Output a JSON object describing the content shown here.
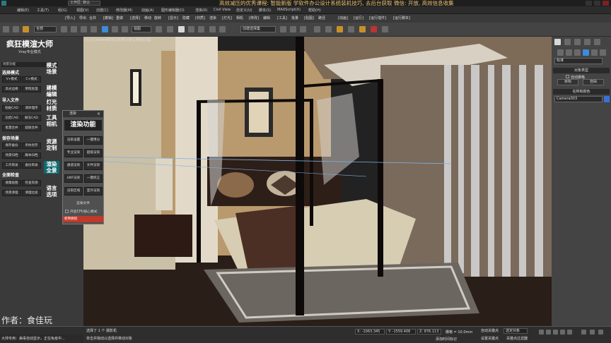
{
  "titlebar": {
    "tab": "工作区: 默认",
    "marquee": "高效减压的优秀课程: 智能新版 学软件办公设计系统装机技巧, 去后台获取  微信: 开放, 高效信息收集"
  },
  "menus": [
    "编辑(E)",
    "工具(T)",
    "组(G)",
    "视图(V)",
    "创建(C)",
    "修改器(M)",
    "动画(A)",
    "图形编辑器(D)",
    "渲染(R)",
    "Civil View",
    "自定义(U)",
    "脚本(S)",
    "MAXScript(X)",
    "帮助(H)"
  ],
  "ribbon_small": [
    "[导入]",
    "导出",
    "合并",
    "[撤销]",
    "重做",
    "[选择]",
    "移动",
    "旋转",
    "[显示]",
    "隐藏",
    "[材质]",
    "渲染",
    "[灯光]",
    "相机",
    "[修改]",
    "编辑",
    "[工具]",
    "批量",
    "[贴图]",
    "路径",
    "[动画]",
    "[运行]",
    "[运行插件]",
    "[运行脚本]"
  ],
  "toolbar": {
    "filter_all": "全部",
    "view_dropdown": "视图",
    "selset_dropdown": "创建选择集"
  },
  "leftpanel": {
    "title": "疯狂模渲大师",
    "subtitle": "Vray专业模式",
    "scene_header": "场景功能",
    "sections": {
      "mode": "选择模式",
      "import": "导入文件",
      "save": "保存场景",
      "check": "全面检查"
    },
    "buttons": [
      [
        "V+模式",
        "C+模式"
      ],
      [
        "高光边缘",
        "明暗处理"
      ],
      [
        "粘贴CAD",
        "调体理序"
      ],
      [
        "冻结CAD",
        "解冻CAD"
      ],
      [
        "批量合并",
        "超级合并"
      ],
      [
        "保存备份",
        "单体另存"
      ],
      [
        "场景归档",
        "脚本归档"
      ],
      [
        "工作目录",
        "备份目录"
      ],
      [
        "收集贴图",
        "检查资源"
      ],
      [
        "场景清理",
        "清理垃圾"
      ]
    ],
    "vtabs": [
      "模式\n场景",
      "建模\n编辑",
      "灯光\n材质",
      "工具\n相机",
      "资源\n定制",
      "渲染\n全景",
      "语言\n选项"
    ],
    "author": "作者：食佳玩"
  },
  "viewport": {
    "label": "[+] [Camera003] [标准] [默认明暗处理]"
  },
  "floatpanel": {
    "header": "渲染",
    "close": "×",
    "title": "渲染功能",
    "buttons": [
      [
        "渲染设置",
        "一键用分"
      ],
      [
        "专业渲染",
        "超级渲染"
      ],
      [
        "通道渲染",
        "文件渲染"
      ],
      [
        "LWF渲染",
        "一键校正"
      ],
      [
        "渲染区域",
        "室外渲染"
      ]
    ],
    "file_label": "渲染文件",
    "checkbox": "开启CPU核心模式",
    "red": "使用教程"
  },
  "rightpanel": {
    "dropdown": "标准",
    "object_type": "对象类型",
    "autogrid": "自动栅格",
    "target": "目标",
    "free": "自由",
    "name_color": "名称和颜色",
    "camera_name": "Camera003"
  },
  "statusbar": {
    "selected": "选择了 1 个 摄影机",
    "hint": "单击并拖动以选择并移动对象",
    "x": "X: -1063.345",
    "y": "Y: -1559.406",
    "z": "Z: 876.113",
    "grid": "栅格 = 10.0mm",
    "autokey": "自动关键点",
    "setkey": "设置关键点",
    "selobj": "选定对象",
    "keyfilter": "关键点过滤器",
    "addtime": "添加时间标记",
    "bottom_left": "大师专用：病毒自动显示，正在免疫中..."
  }
}
